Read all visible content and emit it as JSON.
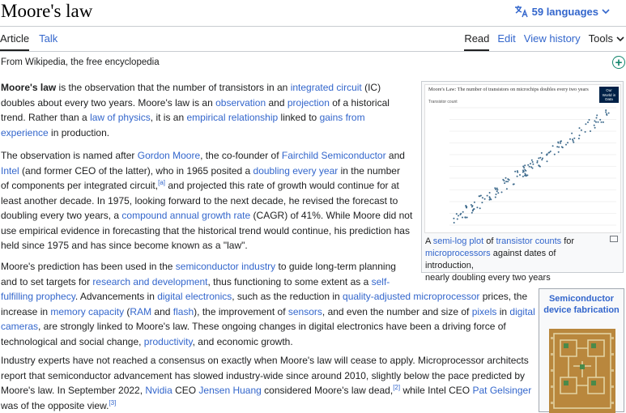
{
  "header": {
    "title": "Moore's law",
    "languages": "59 languages"
  },
  "tabs": {
    "article": "Article",
    "talk": "Talk",
    "read": "Read",
    "edit": "Edit",
    "history": "View history",
    "tools": "Tools"
  },
  "from": "From Wikipedia, the free encyclopedia",
  "p1": {
    "a": "Moore's law",
    "b": " is the observation that the number of transistors in an ",
    "c": "integrated circuit",
    "d": " (IC)",
    "e": "doubles about every two years. Moore's law is an ",
    "f": "observation",
    "g": " and ",
    "h": "projection",
    "i": " of a historical",
    "j": "trend. Rather than a ",
    "k": "law of physics",
    "l": ", it is an ",
    "m": "empirical relationship",
    "n": " linked to ",
    "o": "gains from",
    "p": "experience",
    "q": " in production."
  },
  "p2": {
    "a": "The observation is named after ",
    "b": "Gordon Moore",
    "c": ", the co-founder of ",
    "d": "Fairchild Semiconductor",
    "e": " and",
    "f": "Intel",
    "g": " (and former CEO of the latter), who in 1965 posited a ",
    "h": "doubling every year",
    "i": " in the number",
    "j": "of components per integrated circuit,",
    "k": "[a]",
    "l": " and projected this rate of growth would continue for at",
    "m": "least another decade. In 1975, looking forward to the next decade, he revised the forecast to",
    "n": "doubling every two years, a ",
    "o": "compound annual growth rate",
    "p": " (CAGR) of 41%. While Moore did not",
    "q": "use empirical evidence in forecasting that the historical trend would continue, his prediction has",
    "r": "held since 1975 and has since become known as a \"law\"."
  },
  "p3": {
    "a": "Moore's prediction has been used in the ",
    "b": "semiconductor industry",
    "c": " to guide long-term planning",
    "d": "and to set targets for ",
    "e": "research and development",
    "f": ", thus functioning to some extent as a ",
    "g": "self-",
    "h": "fulfilling prophecy",
    "i": ". Advancements in ",
    "j": "digital electronics",
    "k": ", such as the reduction in ",
    "l": "quality-adjusted microprocessor",
    "m": " prices, the",
    "n": "increase in ",
    "o": "memory capacity",
    "p": " (",
    "q": "RAM",
    "r": " and ",
    "s": "flash",
    "t": "), the improvement of ",
    "u": "sensors",
    "v": ", and even the number and size of ",
    "w": "pixels",
    "x": " in ",
    "y": "digital",
    "z": "cameras",
    "aa": ", are strongly linked to Moore's law. These ongoing changes in digital electronics have been a driving force of",
    "ab": "technological and social change, ",
    "ac": "productivity",
    "ad": ", and economic growth."
  },
  "p4": {
    "a": "Industry experts have not reached a consensus on exactly when Moore's law will cease to apply. Microprocessor architects",
    "b": "report that semiconductor advancement has slowed industry-wide since around 2010, slightly below the pace predicted by",
    "c": "Moore's law. In September 2022, ",
    "d": "Nvidia",
    "e": " CEO ",
    "f": "Jensen Huang",
    "g": " considered Moore's law dead,",
    "h": "[2]",
    "i": " while Intel CEO ",
    "j": "Pat Gelsinger",
    "k": "was of the opposite view.",
    "l": "[3]"
  },
  "figure": {
    "chart_title": "Moore's Law: The number of transistors on microchips doubles every two years",
    "badge": "Our World in Data",
    "ylabel": "Transistor count",
    "cap1": "A ",
    "cap2": "semi-log plot",
    "cap3": " of ",
    "cap4": "transistor counts",
    "cap5": " for",
    "cap6": "microprocessors",
    "cap7": " against dates of introduction,",
    "cap8": "nearly doubling every two years"
  },
  "navbox": {
    "title": "Semiconductor device fabrication"
  },
  "colors": {
    "link": "#3366cc",
    "text": "#202122",
    "border": "#c8ccd1",
    "add": "#14866d"
  }
}
